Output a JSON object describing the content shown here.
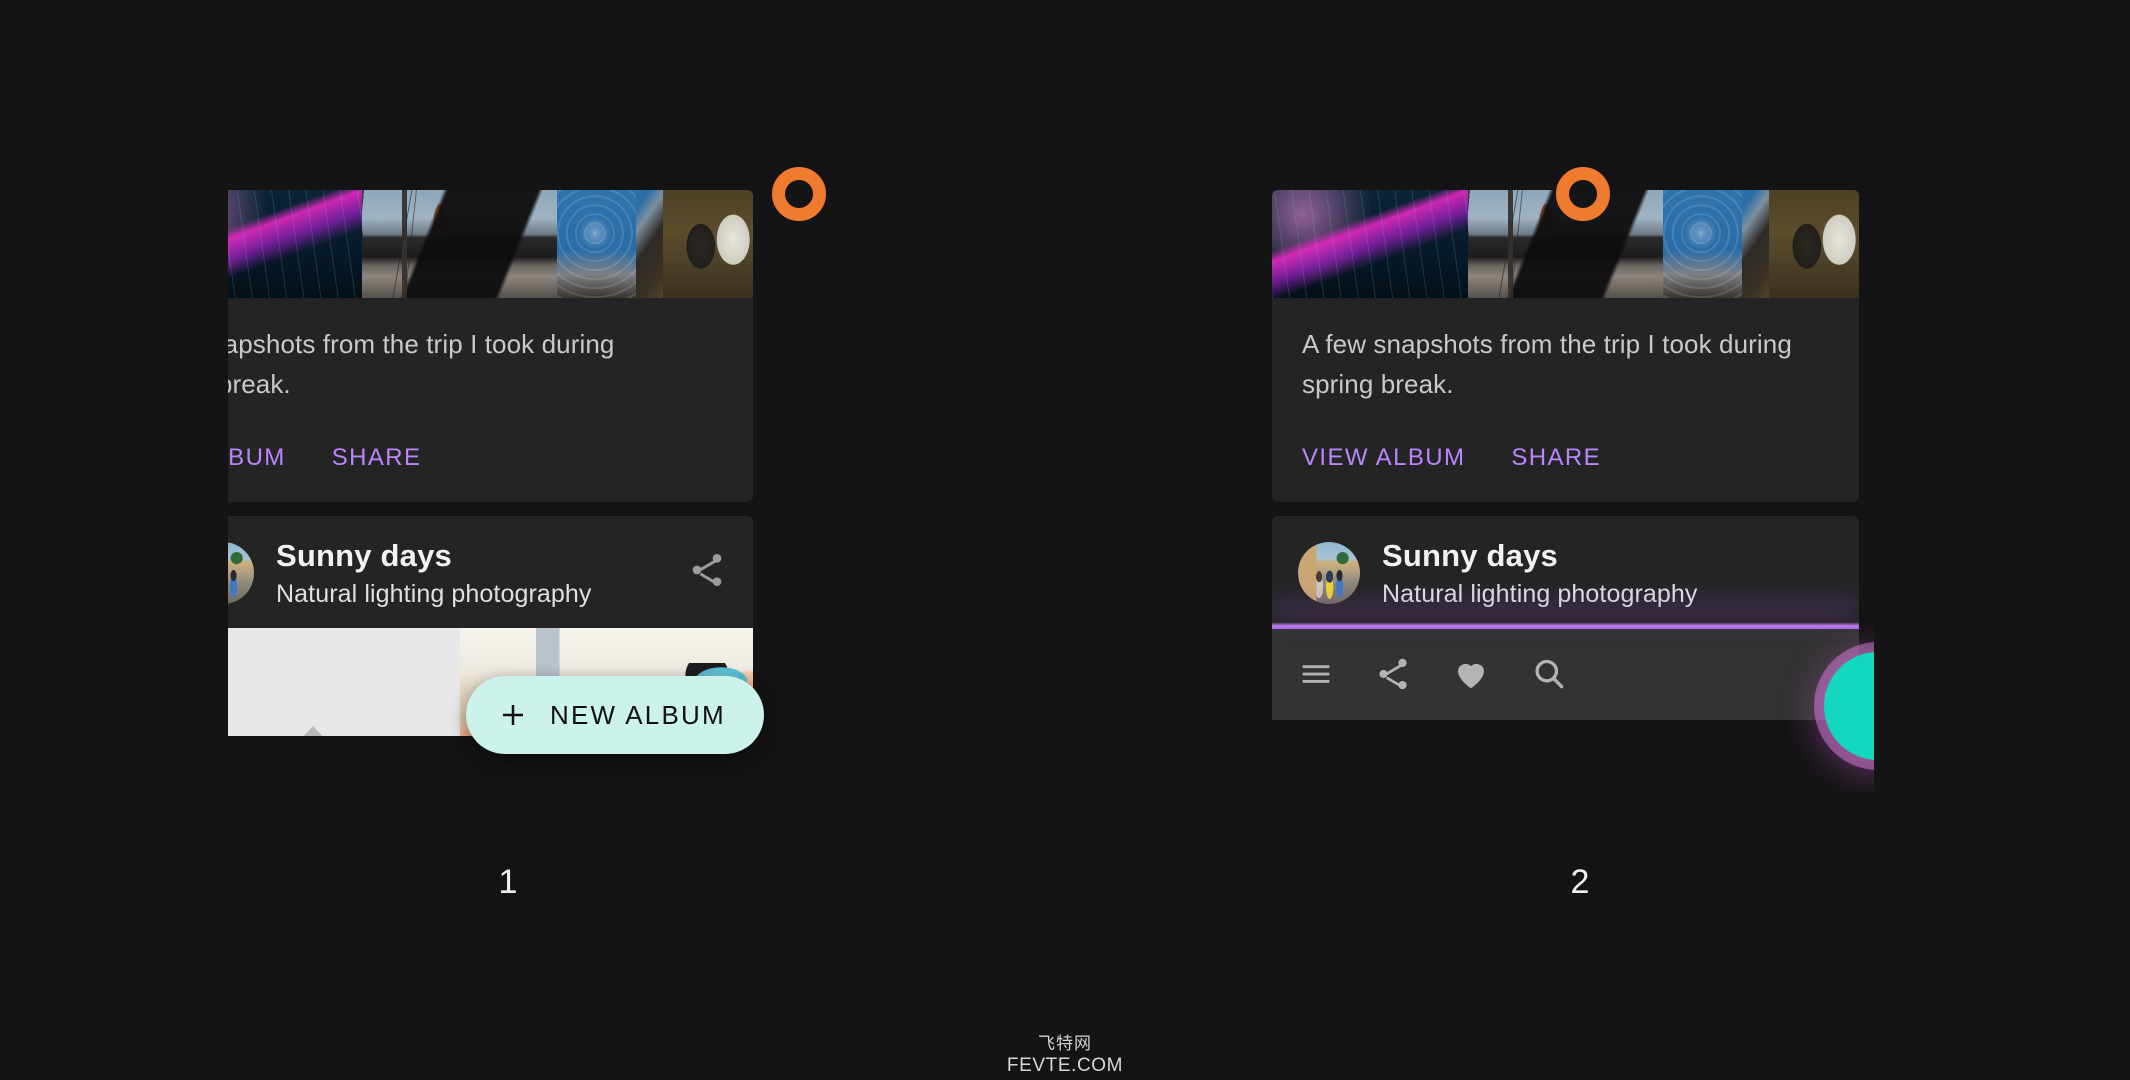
{
  "page": {
    "background_color": "#141414",
    "marker_color": "#ef7c2e",
    "accent_purple": "#bb86fc",
    "fab_mint": "#ccf2ec",
    "fab_teal": "#13d8bf",
    "card_surface": "#242424",
    "bar_surface": "#333333"
  },
  "watermark": {
    "cn": "飞特网",
    "en": "FEVTE.COM"
  },
  "panels": [
    {
      "caption": "1",
      "album_card": {
        "description": "A few snapshots from the trip I took during\nspring break.",
        "description_visible": "snapshots from the trip I took during\ng break.",
        "actions": [
          {
            "label": "VIEW ALBUM",
            "visible_label": "ALBUM",
            "name": "view-album"
          },
          {
            "label": "SHARE",
            "visible_label": "SHARE",
            "name": "share"
          }
        ],
        "thumbnails": [
          {
            "name": "photo-rainy-night"
          },
          {
            "name": "photo-street-bus-window"
          },
          {
            "name": "photo-batik-fabric-cows"
          }
        ]
      },
      "list_card": {
        "title": "Sunny days",
        "subtitle": "Natural lighting photography",
        "share_icon": "share-icon",
        "avatar": "avatar",
        "thumbnails": [
          {
            "name": "photo-placeholder-light"
          },
          {
            "name": "photo-bright-interior"
          }
        ]
      },
      "fab": {
        "type": "extended",
        "icon": "plus-icon",
        "label": "NEW ALBUM"
      },
      "marker": {
        "icon": "ring-marker-icon"
      }
    },
    {
      "caption": "2",
      "album_card": {
        "description": "A few snapshots from the trip I took during\nspring break.",
        "description_visible": "A few snapshots from the trip I took during\nspring break.",
        "actions": [
          {
            "label": "VIEW ALBUM",
            "visible_label": "VIEW ALBUM",
            "name": "view-album"
          },
          {
            "label": "SHARE",
            "visible_label": "SHARE",
            "name": "share"
          }
        ],
        "thumbnails": [
          {
            "name": "photo-rainy-night"
          },
          {
            "name": "photo-street-bus-window"
          },
          {
            "name": "photo-batik-fabric-cows"
          }
        ]
      },
      "list_card": {
        "title": "Sunny days",
        "subtitle": "Natural lighting photography",
        "avatar": "avatar"
      },
      "bottom_bar": {
        "items": [
          {
            "name": "menu-icon"
          },
          {
            "name": "share-icon"
          },
          {
            "name": "favorite-heart-icon"
          },
          {
            "name": "search-icon"
          }
        ]
      },
      "fab": {
        "type": "circular",
        "color": "#13d8bf"
      },
      "marker": {
        "icon": "ring-marker-icon"
      }
    }
  ]
}
